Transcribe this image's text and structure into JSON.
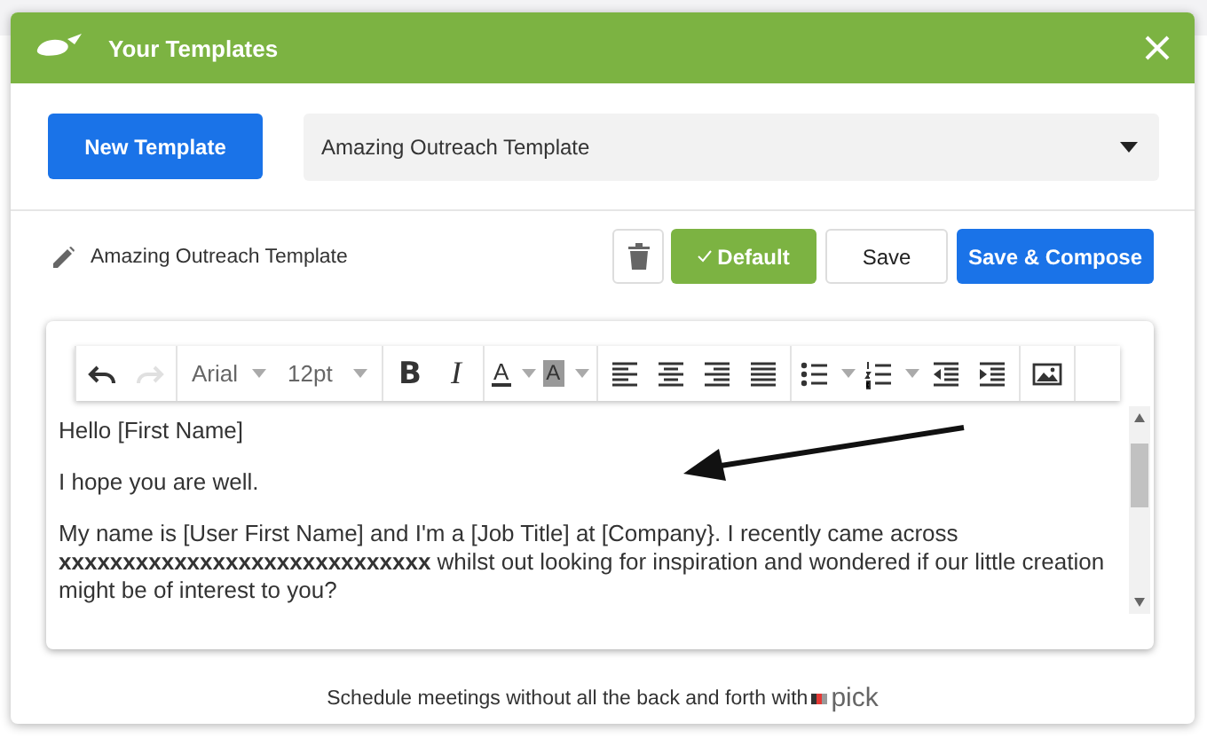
{
  "dialog": {
    "title": "Your Templates"
  },
  "new_button": "New Template",
  "template_select": {
    "value": "Amazing Outreach Template"
  },
  "template_name": "Amazing Outreach Template",
  "actions": [
    {
      "kind": "delete"
    },
    {
      "kind": "default",
      "label": "Default"
    },
    {
      "kind": "save",
      "label": "Save"
    },
    {
      "kind": "compose",
      "label": "Save & Compose"
    }
  ],
  "toolbar": [
    [
      {
        "kind": "undo",
        "disabled": false
      },
      {
        "kind": "redo",
        "disabled": true
      }
    ],
    [
      {
        "kind": "font",
        "label": "Arial",
        "disabled": false
      },
      {
        "kind": "size",
        "label": "12pt",
        "disabled": false
      }
    ],
    [
      {
        "kind": "bold",
        "label": "B",
        "disabled": false
      },
      {
        "kind": "italic",
        "label": "I",
        "disabled": false
      }
    ],
    [
      {
        "kind": "text-color",
        "label": "A",
        "disabled": false
      },
      {
        "kind": "bg-color",
        "label": "A",
        "disabled": false
      }
    ],
    [
      {
        "kind": "align-left",
        "disabled": false
      },
      {
        "kind": "align-center",
        "disabled": false
      },
      {
        "kind": "align-right",
        "disabled": false
      },
      {
        "kind": "justify",
        "disabled": false
      }
    ],
    [
      {
        "kind": "bullets",
        "disabled": false
      },
      {
        "kind": "numbers",
        "disabled": false
      },
      {
        "kind": "outdent",
        "disabled": false
      },
      {
        "kind": "indent",
        "disabled": false
      }
    ],
    [
      {
        "kind": "image",
        "disabled": false
      }
    ]
  ],
  "body": [
    "Hello [First Name]",
    "I hope you are well.",
    "My name is [User First Name] and I'm a [Job Title] at [Company}. I recently came across **xxxxxxxxxxxxxxxxxxxxxxxxxxxxx** whilst out looking for inspiration and wondered if our little creation might be of interest to you?"
  ],
  "footer": {
    "text": "Schedule meetings without all the back and forth with",
    "brand": "pick"
  }
}
